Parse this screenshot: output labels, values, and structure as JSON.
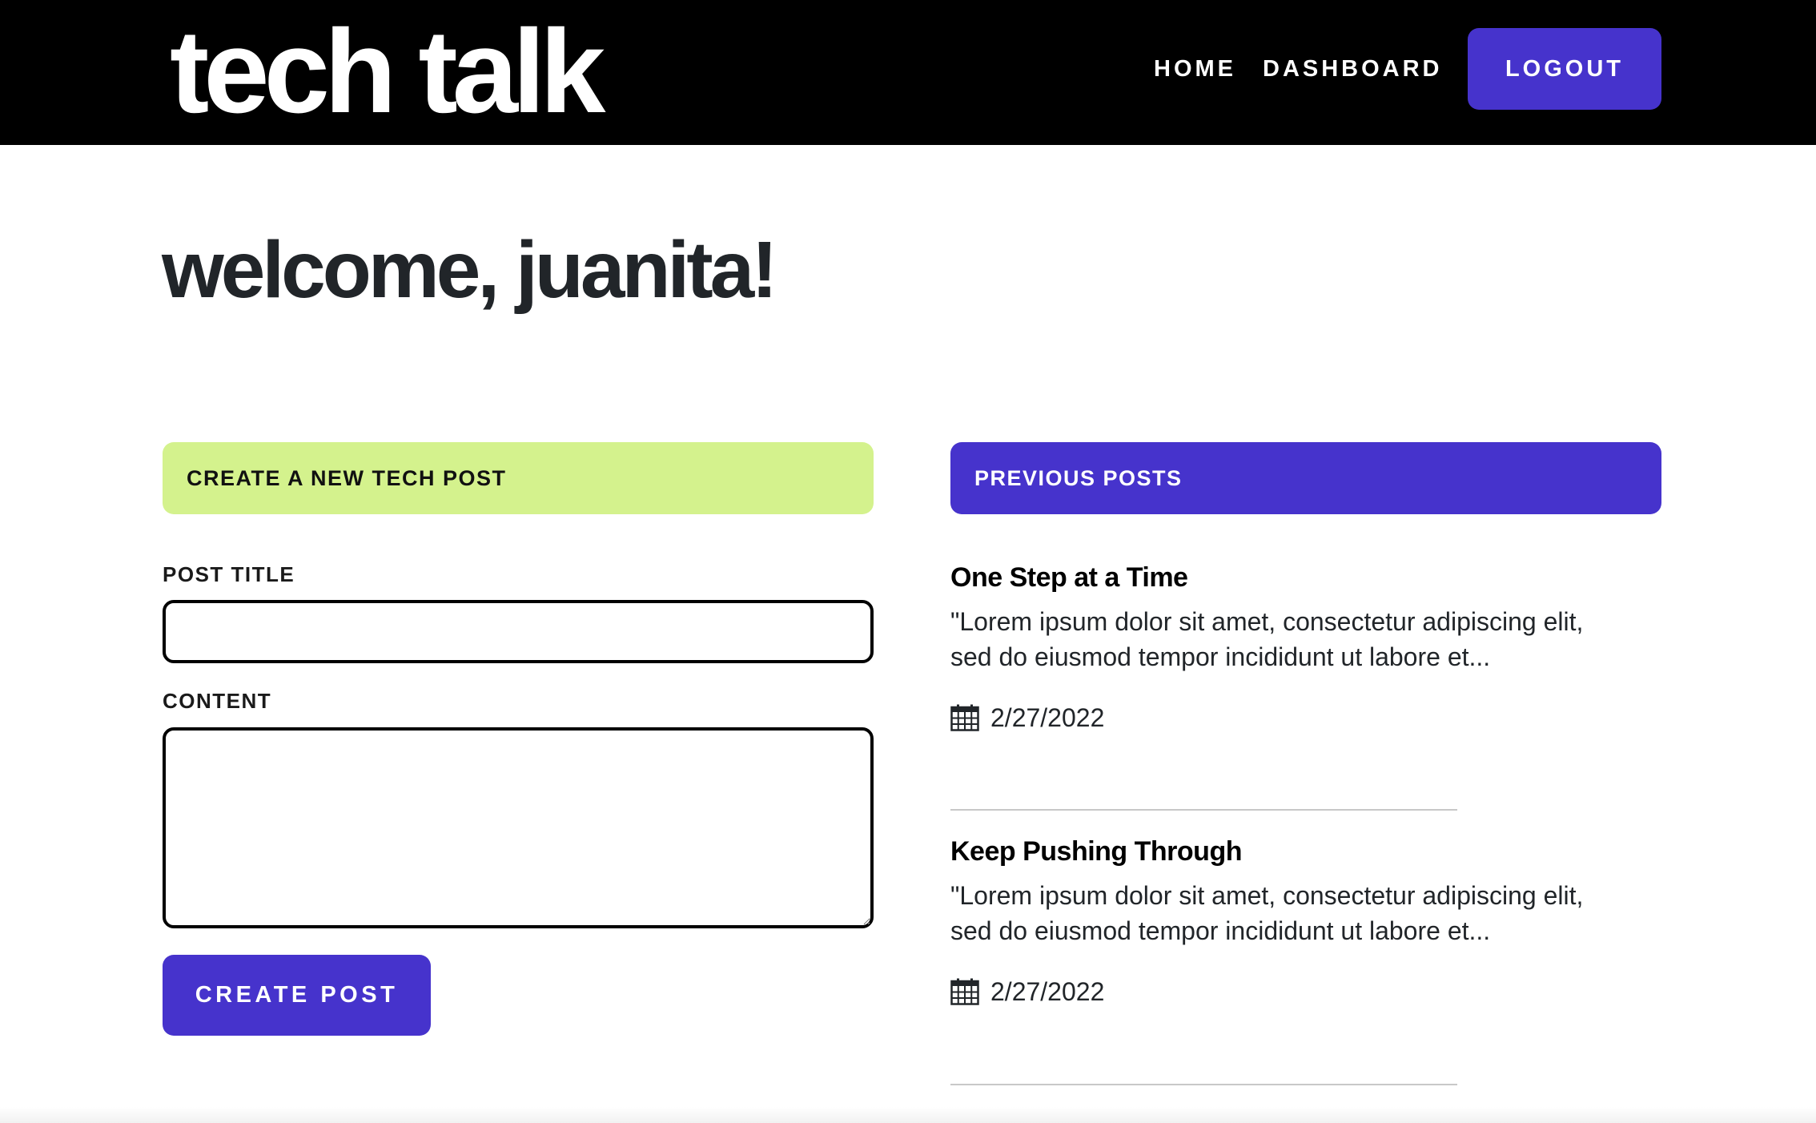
{
  "header": {
    "brand": "tech talk",
    "nav": {
      "home_label": "HOME",
      "dashboard_label": "DASHBOARD",
      "logout_label": "LOGOUT"
    }
  },
  "main": {
    "welcome": "welcome, juanita!",
    "create_panel": {
      "heading": "CREATE A NEW TECH POST",
      "title_label": "POST TITLE",
      "title_value": "",
      "content_label": "CONTENT",
      "content_value": "",
      "submit_label": "CREATE POST"
    },
    "previous_panel": {
      "heading": "PREVIOUS POSTS",
      "posts": [
        {
          "title": "One Step at a Time",
          "excerpt": "\"Lorem ipsum dolor sit amet, consectetur adipiscing elit, sed do eiusmod tempor incididunt ut labore et...",
          "date": "2/27/2022",
          "date_icon": "calendar-icon"
        },
        {
          "title": "Keep Pushing Through",
          "excerpt": "\"Lorem ipsum dolor sit amet, consectetur adipiscing elit, sed do eiusmod tempor incididunt ut labore et...",
          "date": "2/27/2022",
          "date_icon": "calendar-icon"
        }
      ]
    }
  },
  "colors": {
    "header_bg": "#000000",
    "accent": "#4633cc",
    "create_panel_bg": "#d4f28d",
    "text": "#212529"
  }
}
